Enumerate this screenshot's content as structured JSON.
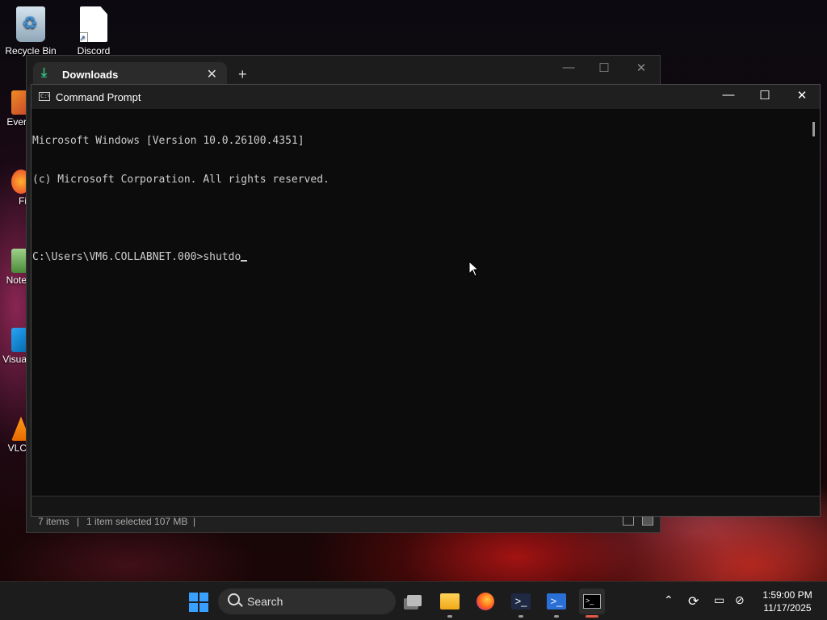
{
  "desktop": {
    "icons": [
      {
        "label": "Recycle Bin"
      },
      {
        "label": "Discord"
      }
    ],
    "side_icons": [
      {
        "label": "Ever"
      },
      {
        "label": "Fi"
      },
      {
        "label": "Note"
      },
      {
        "label": "Visua"
      },
      {
        "label": "VLC"
      }
    ]
  },
  "explorer": {
    "tab_label": "Downloads",
    "status_items": "7 items",
    "status_selected": "1 item selected  107 MB",
    "sep": "|"
  },
  "cmd": {
    "title": "Command Prompt",
    "lines": [
      "Microsoft Windows [Version 10.0.26100.4351]",
      "(c) Microsoft Corporation. All rights reserved.",
      "",
      "C:\\Users\\VM6.COLLABNET.000>shutdo"
    ]
  },
  "taskbar": {
    "search_label": "Search",
    "apps": [
      "start-icon",
      "task-view-icon",
      "file-explorer-icon",
      "firefox-icon",
      "powershell-icon",
      "powershell-alt-icon",
      "terminal-icon"
    ],
    "time": "1:59:00 PM",
    "date": "11/17/2025",
    "accent": "#3aa0ff"
  }
}
